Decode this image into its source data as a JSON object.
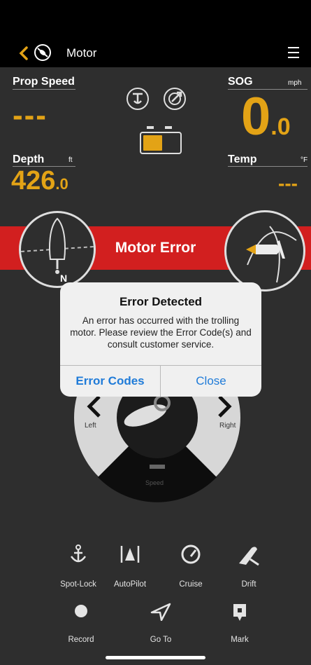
{
  "header": {
    "title": "Motor"
  },
  "prop_speed": {
    "label": "Prop Speed",
    "value": "---"
  },
  "sog": {
    "label": "SOG",
    "unit": "mph",
    "value_int": "0",
    "value_dec": ".0"
  },
  "depth": {
    "label": "Depth",
    "unit": "ft",
    "value_int": "426",
    "value_dec": ".0"
  },
  "temp": {
    "label": "Temp",
    "unit": "°F",
    "value": "---"
  },
  "compass": {
    "heading_letter": "N"
  },
  "error_banner": {
    "text": "Motor Error"
  },
  "dialog": {
    "title": "Error Detected",
    "message": "An error has occurred with the trolling motor. Please review the Error Code(s) and consult customer service.",
    "primary_label": "Error Codes",
    "secondary_label": "Close"
  },
  "steering": {
    "left_label": "Left",
    "right_label": "Right",
    "speed_label": "Speed"
  },
  "tools": [
    {
      "label": "Spot-Lock",
      "icon": "anchor-icon"
    },
    {
      "label": "AutoPilot",
      "icon": "autopilot-icon"
    },
    {
      "label": "Cruise",
      "icon": "speedometer-icon"
    },
    {
      "label": "Drift",
      "icon": "drift-icon"
    },
    {
      "label": "Record",
      "icon": "record-icon"
    },
    {
      "label": "Go To",
      "icon": "goto-arrow-icon"
    },
    {
      "label": "Mark",
      "icon": "waypoint-marker-icon"
    }
  ],
  "colors": {
    "accent": "#e3a316",
    "error": "#d21f1f",
    "link": "#1f7bd8",
    "background": "#2e2e2e"
  }
}
